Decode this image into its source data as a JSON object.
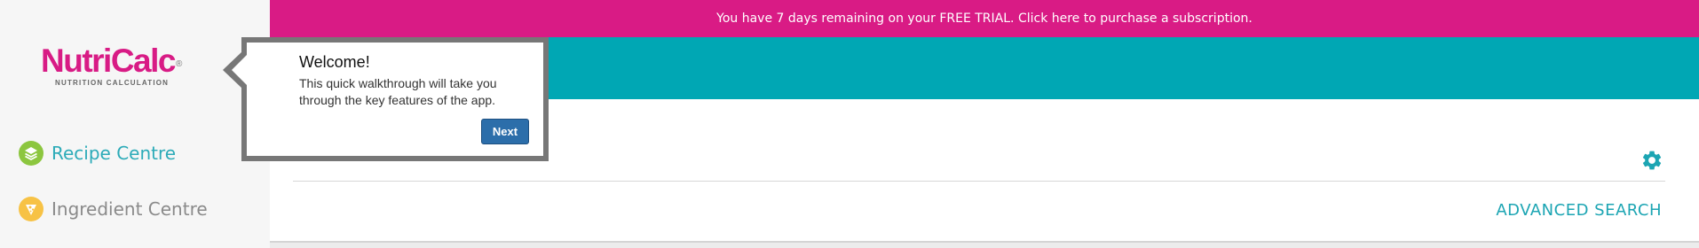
{
  "banner": {
    "text": "You have 7 days remaining on your FREE TRIAL. Click here to purchase a subscription."
  },
  "logo": {
    "name": "NutriCalc",
    "registered": "®",
    "tagline": "NUTRITION CALCULATION"
  },
  "sidebar": {
    "items": [
      {
        "label": "Recipe Centre",
        "icon": "layers-icon",
        "active": true
      },
      {
        "label": "Ingredient Centre",
        "icon": "cheese-icon",
        "active": false
      }
    ]
  },
  "main": {
    "settings_icon": "gear-icon",
    "advanced_search_label": "ADVANCED SEARCH"
  },
  "walkthrough": {
    "title": "Welcome!",
    "body": "This quick walkthrough will take you through the key features of the app.",
    "next_label": "Next"
  },
  "colors": {
    "brand_pink": "#d91b85",
    "teal": "#00a7b4",
    "link_teal": "#1ca5b3",
    "recipe_icon_green": "#8cc63f",
    "ingredient_icon_yellow": "#f7c245",
    "next_button_blue": "#2c6eaa"
  }
}
